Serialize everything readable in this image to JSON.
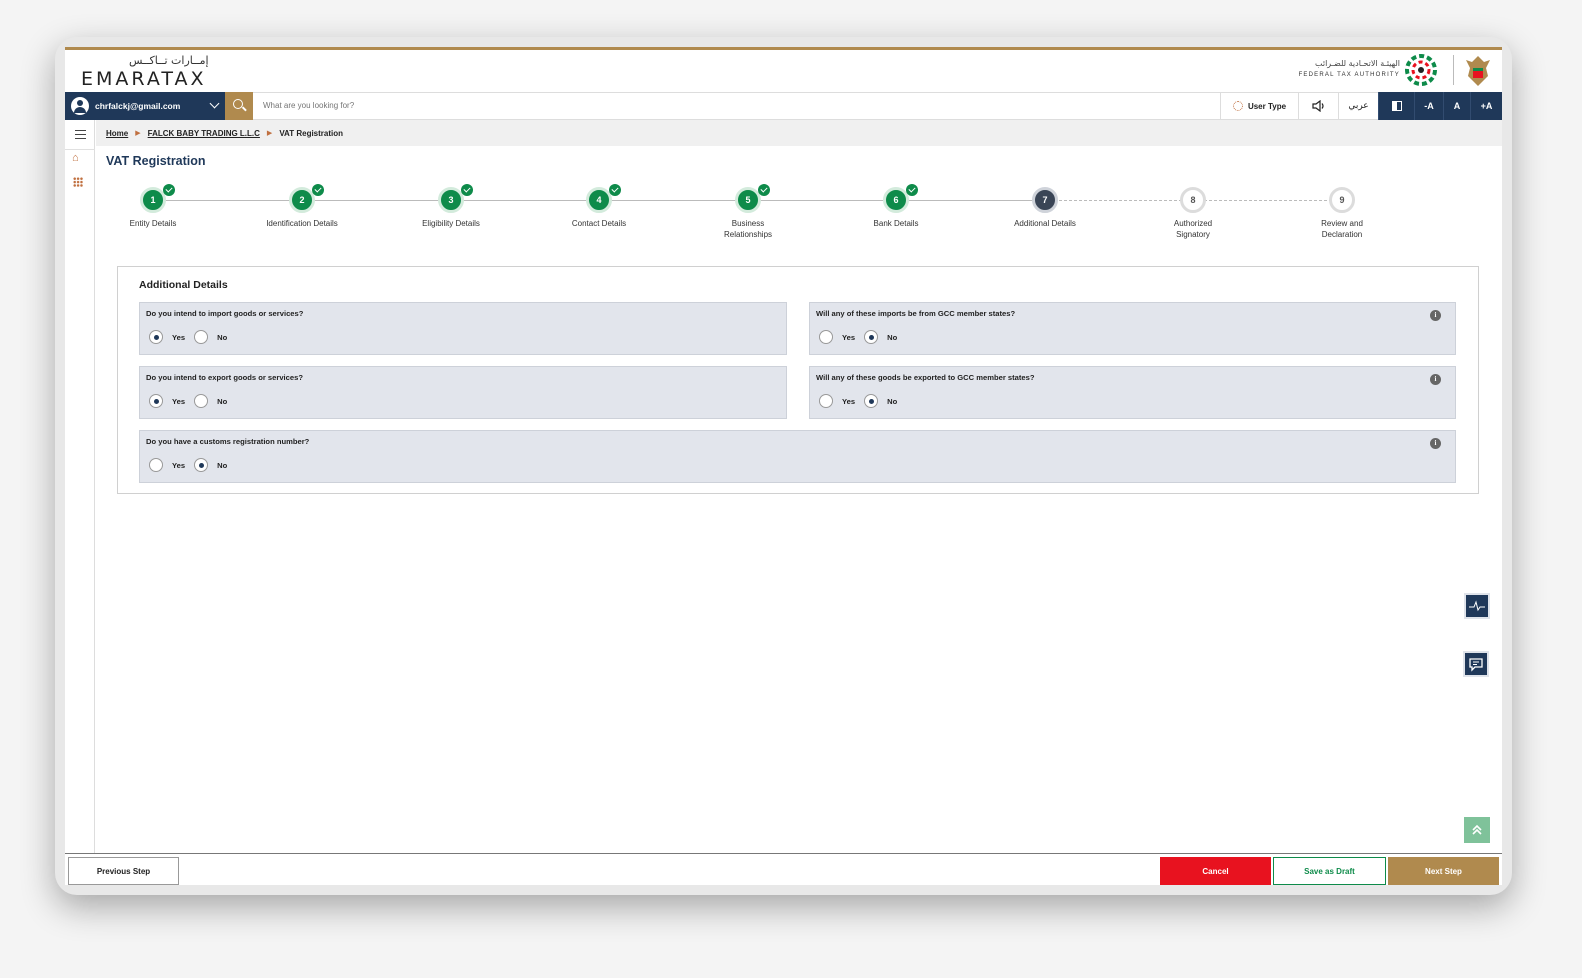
{
  "header": {
    "logo_ar": "إمــارات تــاكــس",
    "logo_en": "EMARATAX",
    "authority_ar": "الهيئـة الاتحـادية للضـرائب",
    "authority_en": "FEDERAL TAX AUTHORITY"
  },
  "topbar": {
    "user_email": "chrfalckj@gmail.com",
    "search_placeholder": "What are you looking for?",
    "user_type": "User Type",
    "language": "عربي",
    "font_decrease": "-A",
    "font_normal": "A",
    "font_increase": "+A"
  },
  "breadcrumb": {
    "home": "Home",
    "company": "FALCK BABY TRADING L.L.C",
    "current": "VAT Registration"
  },
  "page_title": "VAT Registration",
  "steps": [
    {
      "num": "1",
      "label": "Entity Details",
      "status": "done"
    },
    {
      "num": "2",
      "label": "Identification Details",
      "status": "done"
    },
    {
      "num": "3",
      "label": "Eligibility Details",
      "status": "done"
    },
    {
      "num": "4",
      "label": "Contact Details",
      "status": "done"
    },
    {
      "num": "5",
      "label": "Business Relationships",
      "status": "done"
    },
    {
      "num": "6",
      "label": "Bank Details",
      "status": "done"
    },
    {
      "num": "7",
      "label": "Additional Details",
      "status": "current"
    },
    {
      "num": "8",
      "label": "Authorized Signatory",
      "status": "todo"
    },
    {
      "num": "9",
      "label": "Review and Declaration",
      "status": "todo"
    }
  ],
  "card": {
    "title": "Additional Details",
    "options": {
      "yes": "Yes",
      "no": "No"
    },
    "questions": [
      {
        "text": "Do you intend to import goods or services?",
        "selected": "yes",
        "info": false
      },
      {
        "text": "Will any of these imports be from GCC member states?",
        "selected": "no",
        "info": true
      },
      {
        "text": "Do you intend to export goods or services?",
        "selected": "yes",
        "info": false
      },
      {
        "text": "Will any of these goods be exported to GCC member states?",
        "selected": "no",
        "info": true
      },
      {
        "text": "Do you have a customs registration number?",
        "selected": "no",
        "info": true
      }
    ]
  },
  "footer": {
    "previous": "Previous Step",
    "cancel": "Cancel",
    "save_draft": "Save as Draft",
    "next": "Next Step"
  },
  "colors": {
    "navy": "#1f3859",
    "gold": "#b08a4e",
    "green": "#0e8b4a",
    "red": "#e8121f"
  }
}
